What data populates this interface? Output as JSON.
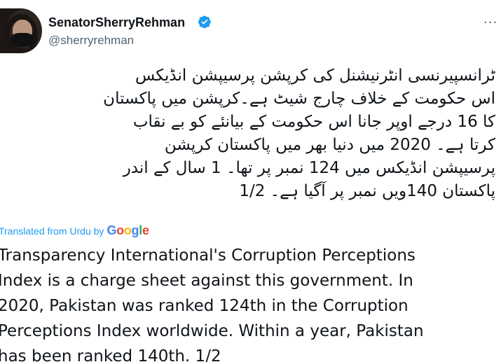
{
  "author": {
    "display_name": "SenatorSherryRehman",
    "handle": "@sherryrehman",
    "verified": true,
    "verified_color": "#1d9bf0"
  },
  "more_menu_glyph": "···",
  "urdu_text_lines": [
    "ٹرانسپیرنسی انٹرنیشنل کی کرپشن پرسیپشن انڈیکس",
    "اس حکومت کے خلاف چارج شیٹ ہے۔کرپشن میں پاکستان",
    "کا 16 درجے اوپر جانا اس حکومت کے بیانئے کو بے نقاب",
    "کرتا ہے۔  2020 میں دنیا بھر میں پاکستان کرپشن",
    "پرسیپشن انڈیکس میں 124 نمبر پر تھا۔ 1 سال کے اندر",
    "پاکستان 140ویں نمبر پر آگیا ہے۔ 1/2"
  ],
  "translation": {
    "label": "Translated from Urdu by",
    "provider_letters": [
      "G",
      "o",
      "o",
      "g",
      "l",
      "e"
    ],
    "provider_colors": [
      "#4285F4",
      "#EA4335",
      "#FBBC05",
      "#4285F4",
      "#34A853",
      "#EA4335"
    ]
  },
  "english_text_lines": [
    "Transparency International's Corruption Perceptions",
    "Index is a charge sheet against this government. In",
    "2020, Pakistan was ranked 124th in the Corruption",
    "Perceptions Index worldwide. Within a year, Pakistan",
    "has been ranked 140th. 1/2"
  ]
}
